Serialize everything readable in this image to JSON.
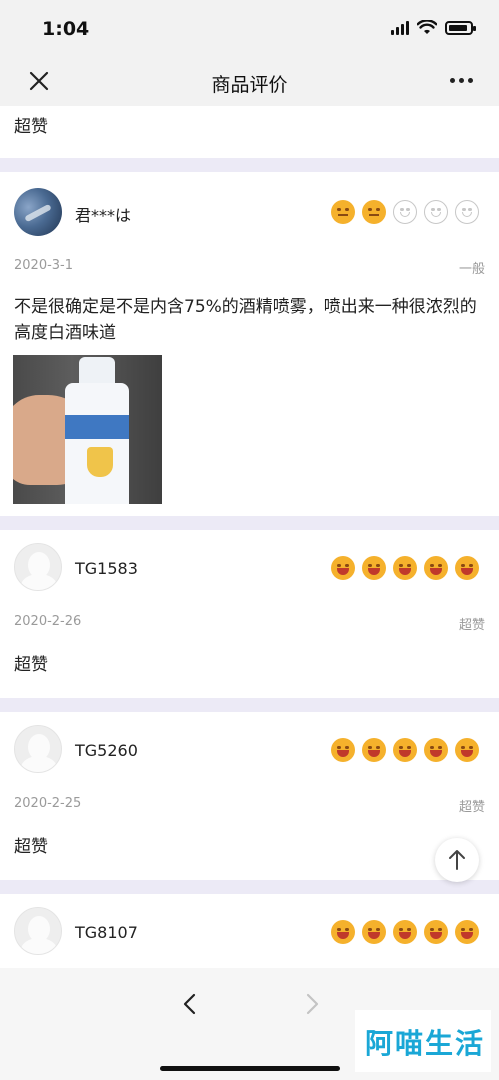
{
  "status_bar": {
    "time": "1:04"
  },
  "nav": {
    "title": "商品评价"
  },
  "reviews": [
    {
      "content": "超赞"
    },
    {
      "user": "君***は",
      "rating": 2,
      "date": "2020-3-1",
      "level": "一般",
      "content": "不是很确定是不是内含75%的酒精喷雾，喷出来一种很浓烈的高度白酒味道",
      "has_photo": true
    },
    {
      "user": "TG1583",
      "rating": 5,
      "date": "2020-2-26",
      "level": "超赞",
      "content": "超赞"
    },
    {
      "user": "TG5260",
      "rating": 5,
      "date": "2020-2-25",
      "level": "超赞",
      "content": "超赞"
    },
    {
      "user": "TG8107",
      "rating": 5
    }
  ],
  "watermark": {
    "text": "阿喵生活"
  },
  "colors": {
    "star_on": "#f5b12c",
    "star_off": "#c7c7c7",
    "divider": "#eceaf6"
  },
  "icons": {
    "close": "close-icon",
    "more": "more-icon",
    "back": "chevron-left-icon",
    "forward": "chevron-right-icon",
    "scroll_top": "arrow-up-icon"
  }
}
